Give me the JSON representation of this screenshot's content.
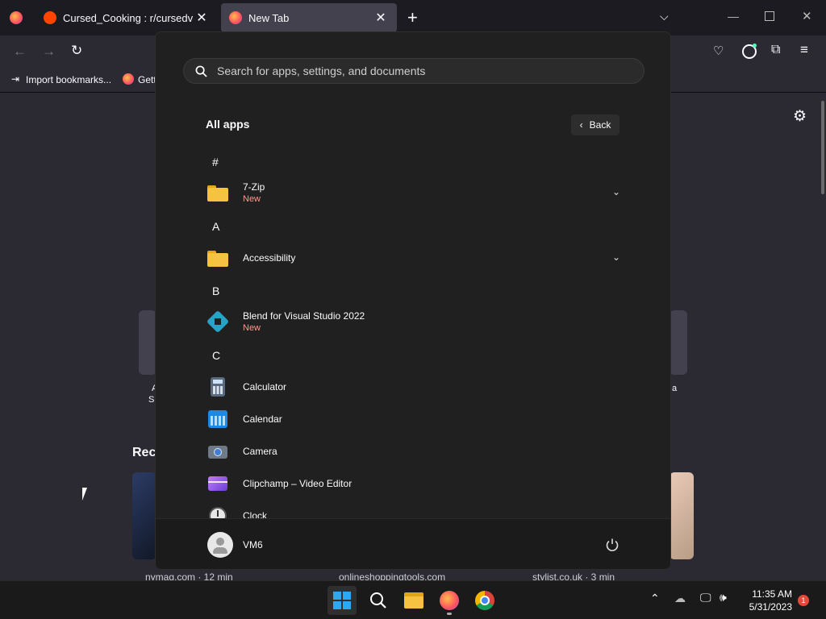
{
  "browser": {
    "tabs": [
      {
        "title": "Cursed_Cooking : r/cursedvideos",
        "active": false
      },
      {
        "title": "New Tab",
        "active": true
      }
    ],
    "new_tab_label": "+",
    "bookmarks": [
      {
        "label": "Import bookmarks..."
      },
      {
        "label": "Gett"
      }
    ],
    "page": {
      "recent_heading": "Rec",
      "thumbs": [
        {
          "caption": "nymag.com · 12 min"
        },
        {
          "caption": "onlineshoppingtools.com"
        },
        {
          "caption": "stylist.co.uk · 3 min"
        }
      ],
      "side_left": "A",
      "side_left2": "Sp",
      "side_right": "a"
    }
  },
  "start_menu": {
    "search_placeholder": "Search for apps, settings, and documents",
    "heading": "All apps",
    "back_label": "Back",
    "letters": [
      "#",
      "A",
      "B",
      "C"
    ],
    "apps": [
      {
        "name": "7-Zip",
        "badge": "New",
        "icon": "folder-icon",
        "expandable": true
      },
      {
        "name": "Accessibility",
        "badge": "",
        "icon": "folder-icon",
        "expandable": true
      },
      {
        "name": "Blend for Visual Studio 2022",
        "badge": "New",
        "icon": "blend-icon",
        "expandable": false
      },
      {
        "name": "Calculator",
        "badge": "",
        "icon": "calculator-icon",
        "expandable": false
      },
      {
        "name": "Calendar",
        "badge": "",
        "icon": "calendar-icon",
        "expandable": false
      },
      {
        "name": "Camera",
        "badge": "",
        "icon": "camera-icon",
        "expandable": false
      },
      {
        "name": "Clipchamp – Video Editor",
        "badge": "",
        "icon": "clipchamp-icon",
        "expandable": false
      },
      {
        "name": "Clock",
        "badge": "",
        "icon": "clock-icon",
        "expandable": false
      }
    ],
    "user": "VM6"
  },
  "taskbar": {
    "time": "11:35 AM",
    "date": "5/31/2023",
    "notification_count": "1"
  },
  "colors": {
    "accent_new": "#ff9a8a",
    "folder": "#f5c242",
    "start_bg": "#202020"
  }
}
